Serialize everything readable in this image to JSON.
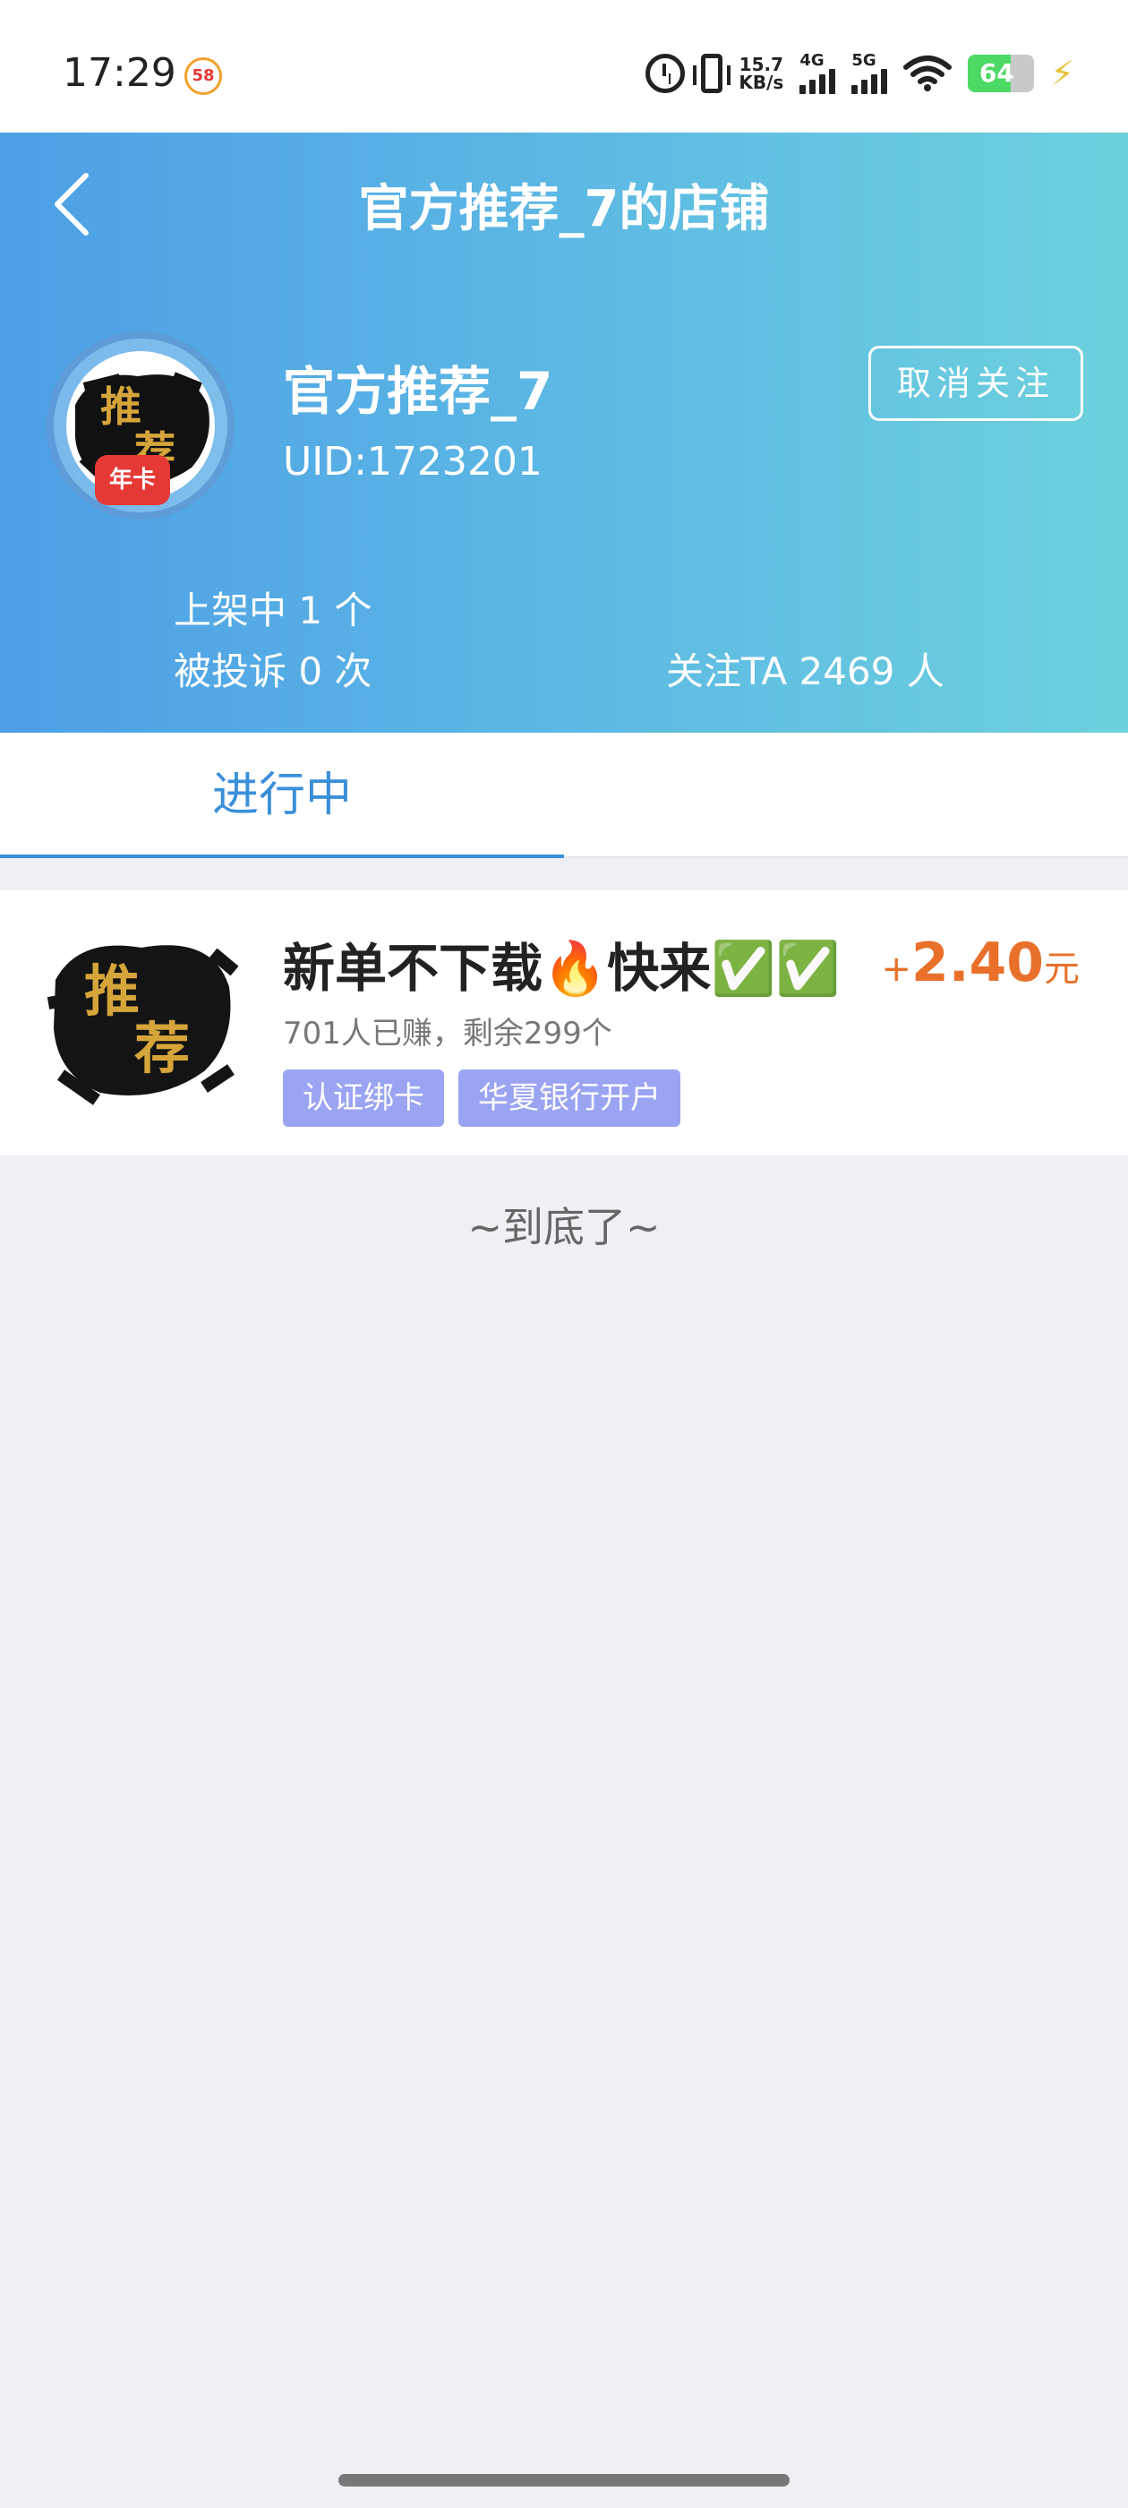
{
  "status_bar": {
    "time": "17:29",
    "app_badge": "58",
    "net_speed_value": "15.7",
    "net_speed_unit": "KB/s",
    "sim1_label": "4G",
    "sim2_label": "5G",
    "battery": "64"
  },
  "header": {
    "title": "官方推荐_7的店铺"
  },
  "shop": {
    "name": "官方推荐_7",
    "uid": "UID:1723201",
    "badge": "年卡",
    "unfollow_label": "取消关注",
    "on_shelf": "上架中 1 个",
    "complaints": "被投诉 0 次",
    "followers": "关注TA 2469 人"
  },
  "tabs": [
    {
      "label": "进行中",
      "active": true
    }
  ],
  "tasks": [
    {
      "title": "新单不下载🔥快来✅✅",
      "meta": "701人已赚，剩余299个",
      "tags": [
        "认证绑卡",
        "华夏银行开户"
      ],
      "price_plus": "+",
      "price_amount": "2.40",
      "price_unit": "元"
    }
  ],
  "list_end_text": "~到底了~",
  "colors": {
    "accent": "#3a8fd9",
    "price": "#e8702a",
    "tag_bg": "#9aa4f2",
    "header_gradient_start": "#4d9fe6",
    "header_gradient_end": "#6dd1dd"
  }
}
